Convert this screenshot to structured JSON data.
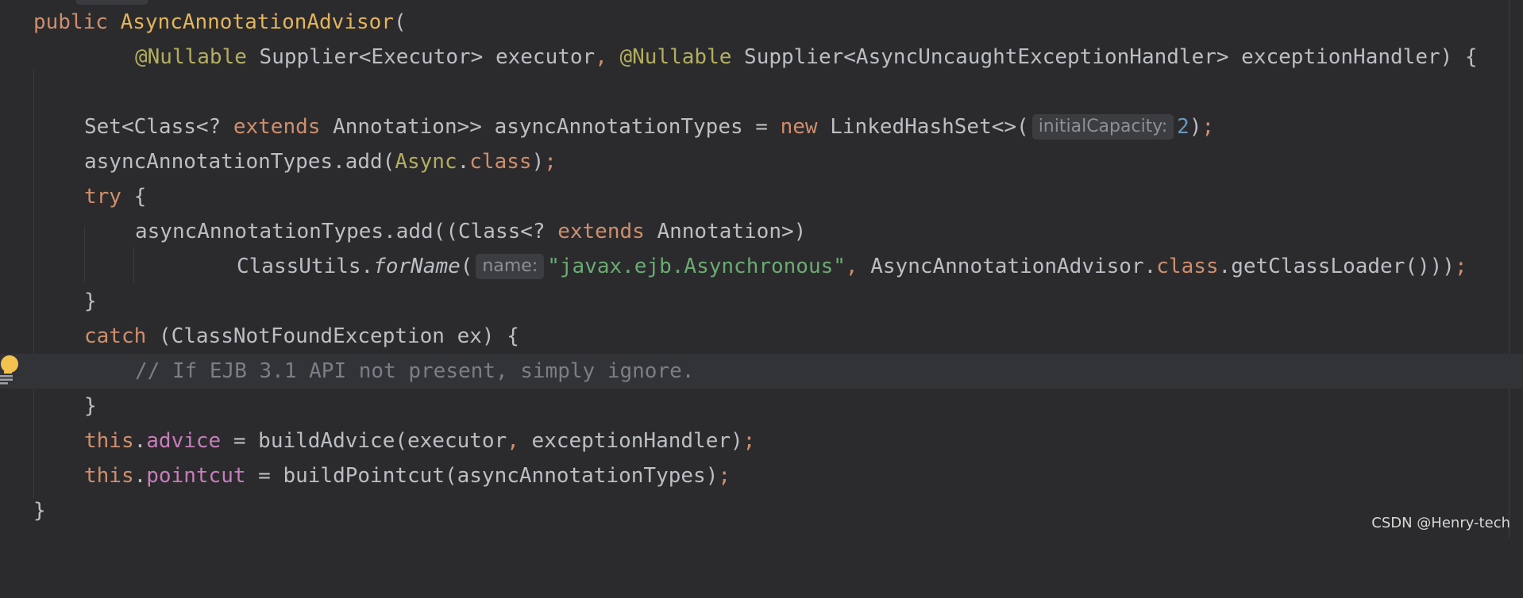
{
  "editor": {
    "lines": {
      "l1": {
        "kw": "public",
        "name": "AsyncAnnotationAdvisor",
        "paren": "("
      },
      "l2": {
        "ann1": "@Nullable",
        "type1": " Supplier<Executor> executor",
        "comma": ",",
        "ann2": " @Nullable",
        "type2": " Supplier<AsyncUncaughtExceptionHandler> exceptionHandler) {"
      },
      "l4": {
        "a": "Set<Class<? ",
        "kw": "extends",
        "b": " Annotation>> asyncAnnotationTypes = ",
        "kw2": "new",
        "c": " LinkedHashSet<>(",
        "hint": "initialCapacity:",
        "num": "2",
        "d": ")",
        "semi": ";"
      },
      "l5": {
        "a": "asyncAnnotationTypes.add(",
        "cls": "Async",
        "dot": ".",
        "kw": "class",
        "b": ")",
        "semi": ";"
      },
      "l6": {
        "kw": "try",
        "a": " {"
      },
      "l7": {
        "a": "asyncAnnotationTypes.add((Class<? ",
        "kw": "extends",
        "b": " Annotation>)"
      },
      "l8": {
        "a": "ClassUtils.",
        "method": "forName",
        "b": "(",
        "hint": "name:",
        "str": "\"javax.ejb.Asynchronous\"",
        "comma": ",",
        "c": " AsyncAnnotationAdvisor.",
        "kw": "class",
        "d": ".getClassLoader()))",
        "semi": ";"
      },
      "l9": {
        "a": "}"
      },
      "l10": {
        "kw": "catch",
        "a": " (ClassNotFoundException ex) {"
      },
      "l11": {
        "cmt": "// If EJB 3.1 API not present, simply ignore."
      },
      "l12": {
        "a": "}"
      },
      "l13": {
        "kw": "this",
        "dot": ".",
        "field": "advice",
        "a": " = buildAdvice(executor",
        "comma": ",",
        "b": " exceptionHandler)",
        "semi": ";"
      },
      "l14": {
        "kw": "this",
        "dot": ".",
        "field": "pointcut",
        "a": " = buildPointcut(asyncAnnotationTypes)",
        "semi": ";"
      },
      "l15": {
        "a": "}"
      }
    }
  },
  "watermark": "CSDN @Henry-tech",
  "colors": {
    "background": "#2b2b2d",
    "keyword": "#cf8e6d",
    "declaration": "#e3b45b",
    "annotation": "#b3ae60",
    "string": "#6aab73",
    "number": "#6897bb",
    "field": "#c77dbb",
    "comment": "#7a7e85",
    "text": "#bcbec4"
  },
  "icons": {
    "gutter": "lightbulb-icon"
  }
}
